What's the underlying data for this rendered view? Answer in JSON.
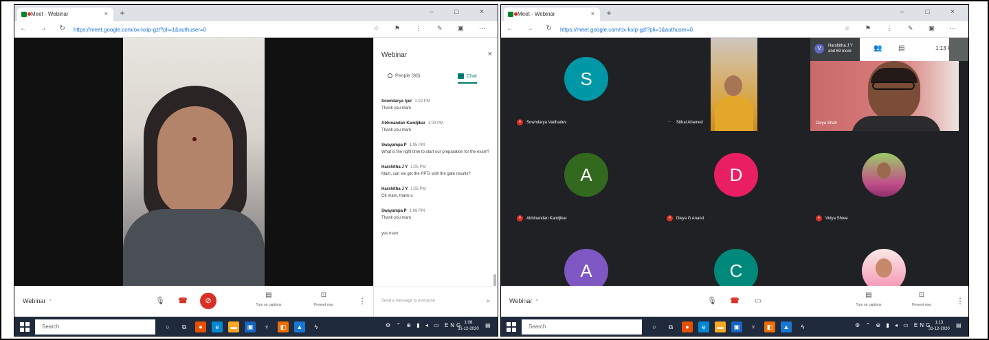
{
  "left": {
    "browser": {
      "tab_title": "Meet - Webinar",
      "tab_close": "×",
      "new_tab": "+",
      "window_controls": "–  □  ×",
      "nav": "←  →  ↻",
      "url": "https://meet.google.com/ox-kxip-gzl?pli=1&authuser=0",
      "tools": "☆ ⚑ ⋮ ✎ ▣ ⋯"
    },
    "panel": {
      "title": "Webinar",
      "close": "×",
      "people_tab": "People (80)",
      "chat_tab": "Chat",
      "messages": [
        {
          "sender": "Sowndarya Iyer",
          "time": "1:02 PM",
          "text": "Thank you mam"
        },
        {
          "sender": "Abhinandan Kandjikar",
          "time": "1:03 PM",
          "text": "Thank you mam"
        },
        {
          "sender": "Swayampa P",
          "time": "1:05 PM",
          "text": "What is the right time to start our preparation for the exam?"
        },
        {
          "sender": "Harshitha J Y",
          "time": "1:05 PM",
          "text": "Mam, can we get the PPTs with the gate results?"
        },
        {
          "sender": "Harshitha J Y",
          "time": "1:05 PM",
          "text": "Ok mam, thank u"
        },
        {
          "sender": "Swayampa P",
          "time": "1:06 PM",
          "text": "Thank you mam"
        },
        {
          "sender": "",
          "time": "",
          "text": "yes mam"
        }
      ],
      "compose_placeholder": "Send a message to everyone",
      "send": "➤"
    },
    "bottombar": {
      "meeting_name": "Webinar",
      "chevron": "⌃",
      "mic": "🎙",
      "end": "☎",
      "cam": "⊘",
      "captions_glyph": "▤",
      "captions_label": "Turn on captions",
      "present_glyph": "⊡",
      "present_label": "Present now",
      "more": "⋮"
    },
    "taskbar": {
      "search": "Search",
      "tray": "⚙ ⌃ ⊕ ▮ ◂ ▭ ENG",
      "time": "1:08",
      "date": "31-12-2020",
      "notify": "▤"
    }
  },
  "right": {
    "browser": {
      "tab_title": "Meet - Webinar",
      "tab_close": "×",
      "new_tab": "+",
      "window_controls": "–  □  ×",
      "nav": "←  →  ↻",
      "url": "https://meet.google.com/ox-kxip-gzl?pli=1&authuser=0",
      "tools": "☆ ⚑ ⋮ ✎ ▣ ⋯"
    },
    "hud": {
      "presenter_initial": "V",
      "presenter_line1": "Harshitha J Y",
      "presenter_line2": "and 69 more",
      "people_icon": "👥",
      "chat_icon": "▤",
      "time": "1:13 PM"
    },
    "tiles": [
      {
        "initial": "S",
        "color": "#0097a7",
        "name": "Sowndarya Vadhadev"
      },
      {
        "initial": "",
        "color": "",
        "name": "Sithal Ahamed"
      },
      {
        "initial": "",
        "color": "",
        "name": "Divya Shah"
      },
      {
        "initial": "A",
        "color": "#33691e",
        "name": "Abhinandan Kandjikar"
      },
      {
        "initial": "D",
        "color": "#e91e63",
        "name": "Divya G Anand"
      },
      {
        "initial": "",
        "color": "",
        "name": "Vidya Shree"
      },
      {
        "initial": "A",
        "color": "#7e57c2",
        "name": ""
      },
      {
        "initial": "C",
        "color": "#00897b",
        "name": ""
      },
      {
        "initial": "",
        "color": "",
        "name": ""
      }
    ],
    "bottombar": {
      "meeting_name": "Webinar",
      "chevron": "⌃",
      "mic": "🎙",
      "end": "☎",
      "cam": "▭",
      "captions_glyph": "▤",
      "captions_label": "Turn on captions",
      "present_glyph": "⊡",
      "present_label": "Present now",
      "more": "⋮"
    },
    "taskbar": {
      "search": "Search",
      "tray": "⚙ ⌃ ⊕ ▮ ◂ ▭ ENG",
      "time": "1:13",
      "date": "31-12-2020",
      "notify": "▤"
    }
  }
}
